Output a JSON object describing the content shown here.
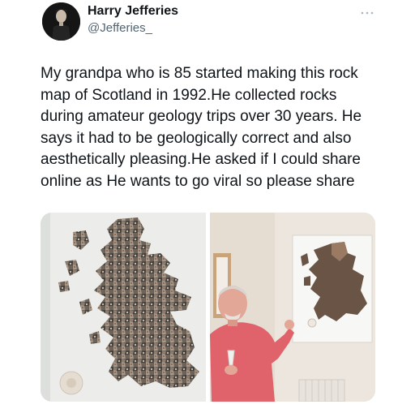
{
  "author": {
    "display_name": "Harry Jefferies",
    "handle": "@Jefferies_"
  },
  "tweet": {
    "text": "My grandpa who is 85 started making this rock\nmap of Scotland in 1992.He collected rocks\nduring amateur geology trips over 30 years. He\nsays it had to be geologically correct and also\naesthetically pleasing.He asked if I could share\nonline as He wants to go viral so please share"
  },
  "media": [
    {
      "subject": "rock-map-of-scotland-closeup"
    },
    {
      "subject": "grandpa-pointing-at-rock-map"
    }
  ],
  "icons": {
    "more": "more-horizontal-icon"
  },
  "colors": {
    "text_primary": "#0f1419",
    "text_secondary": "#536471",
    "more_icon": "#aab8c2",
    "shirt": "#e0636b"
  }
}
